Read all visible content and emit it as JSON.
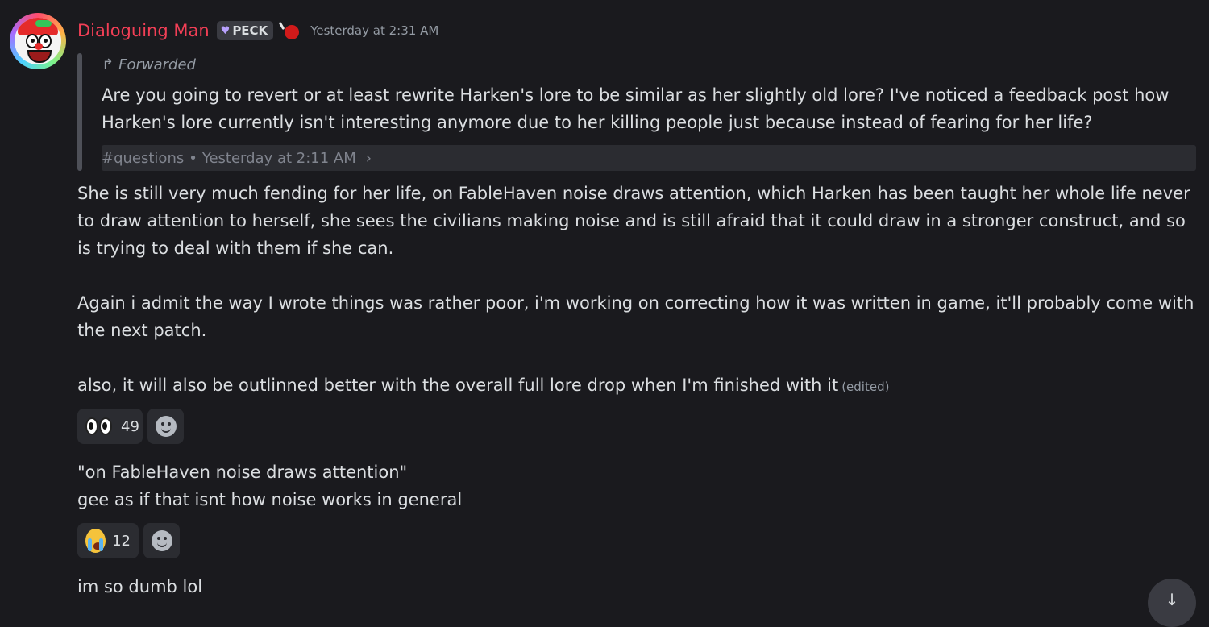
{
  "message": {
    "author": "Dialoguing Man",
    "guild_tag": "PECK",
    "timestamp": "Yesterday at 2:31 AM",
    "forwarded": {
      "label": "Forwarded",
      "text": "Are you going to revert or at least rewrite Harken's lore to be similar as her slightly old lore? I've noticed a feedback post how Harken's lore currently isn't interesting anymore due to her killing people just because instead of fearing for her life?",
      "channel": "#questions",
      "separator": "•",
      "time": "Yesterday at 2:11 AM"
    },
    "paragraphs": [
      "She is still very much fending for her life, on FableHaven noise draws attention, which Harken has been taught her whole life never to draw attention to herself, she sees the civilians making noise and is still afraid that it could draw in a stronger construct, and so is trying to deal with them if she can.",
      "Again i admit the way I wrote things was rather poor, i'm working on correcting how it was written in game, it'll probably come with the next patch.",
      "also, it will also be outlinned better with the overall full lore drop when I'm finished with it"
    ],
    "edited_label": "(edited)",
    "reactions": [
      {
        "emoji": "eyes",
        "count": "49"
      }
    ]
  },
  "followups": [
    {
      "lines": [
        "\"on FableHaven noise draws attention\"",
        "gee as if that isnt how noise works in general"
      ],
      "reactions": [
        {
          "emoji": "sob",
          "count": "12"
        }
      ]
    },
    {
      "lines": [
        "im so dumb lol"
      ]
    }
  ],
  "icons": {
    "forward": "↱",
    "chevron": "›",
    "scroll_down": "↓"
  },
  "colors": {
    "background": "#1a1a1e",
    "username": "#f23f56",
    "text": "#dbdee1",
    "muted": "#949ba4",
    "reaction_bg": "#2b2c31"
  }
}
